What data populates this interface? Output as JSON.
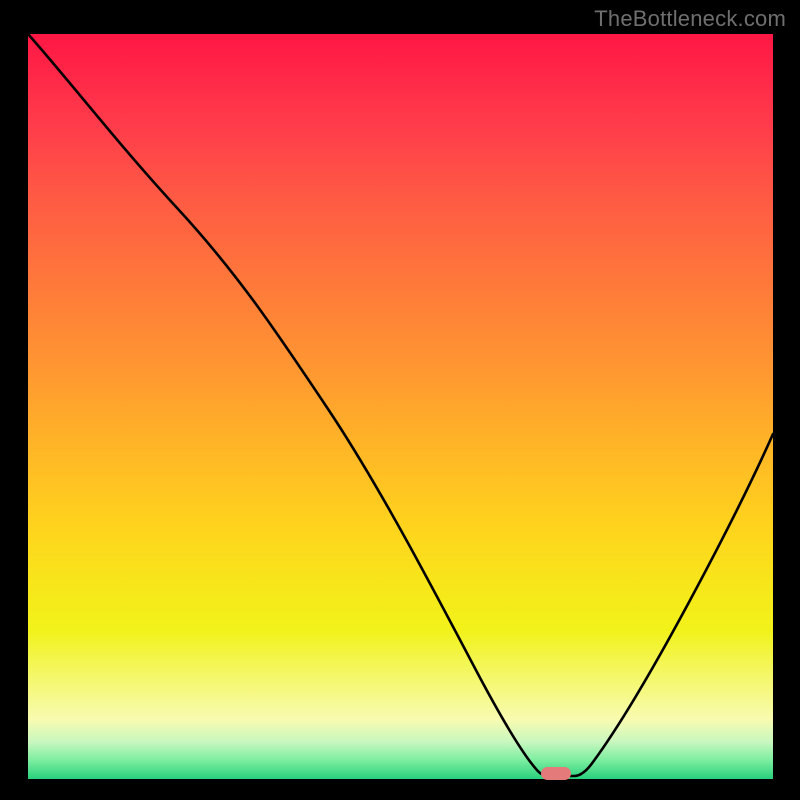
{
  "watermark": "TheBottleneck.com",
  "chart_data": {
    "type": "line",
    "title": "",
    "xlabel": "",
    "ylabel": "",
    "xlim": [
      0,
      100
    ],
    "ylim": [
      0,
      100
    ],
    "x": [
      0,
      4,
      8,
      12,
      16,
      20,
      24,
      28,
      32,
      36,
      40,
      44,
      48,
      52,
      56,
      60,
      64,
      66,
      68,
      70,
      72,
      76,
      80,
      84,
      88,
      92,
      96,
      100
    ],
    "values": [
      100,
      96,
      91,
      86,
      81,
      76,
      69,
      62,
      56,
      50,
      44,
      38,
      32,
      26,
      20,
      14,
      8,
      5,
      2,
      0.5,
      0.5,
      3,
      10,
      19,
      28,
      37,
      46,
      55
    ],
    "minimum_marker": {
      "x": 70,
      "y": 0.5
    },
    "background_gradient": {
      "top": "#ff1744",
      "mid": "#ffc107",
      "bottom": "#28d07c"
    },
    "frame_color": "#000000"
  }
}
